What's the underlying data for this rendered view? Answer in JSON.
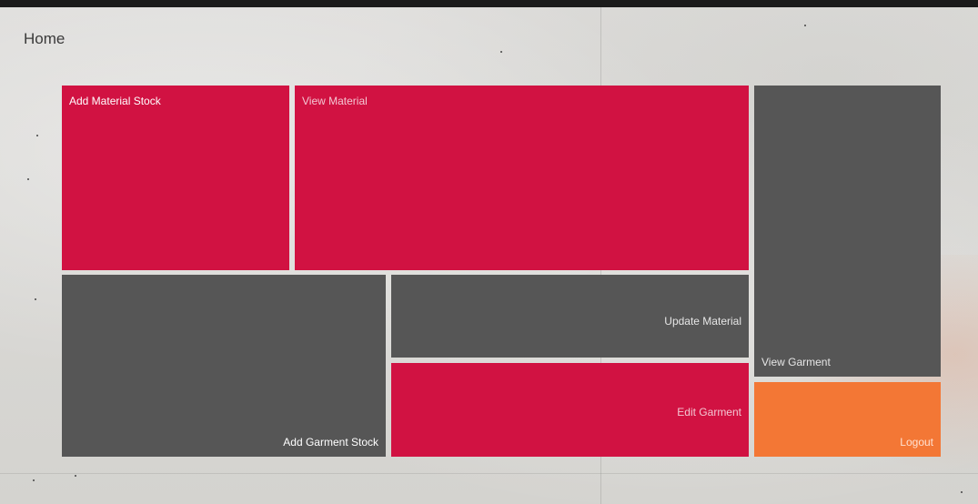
{
  "header": {
    "title": "Home"
  },
  "tiles": {
    "add_material_stock": "Add Material Stock",
    "view_material": "View Material",
    "view_garment": "View Garment",
    "add_garment_stock": "Add Garment Stock",
    "update_material": "Update Material",
    "edit_garment": "Edit Garment",
    "logout": "Logout"
  },
  "colors": {
    "red": "#d11242",
    "dark": "#565656",
    "orange": "#f37735"
  }
}
